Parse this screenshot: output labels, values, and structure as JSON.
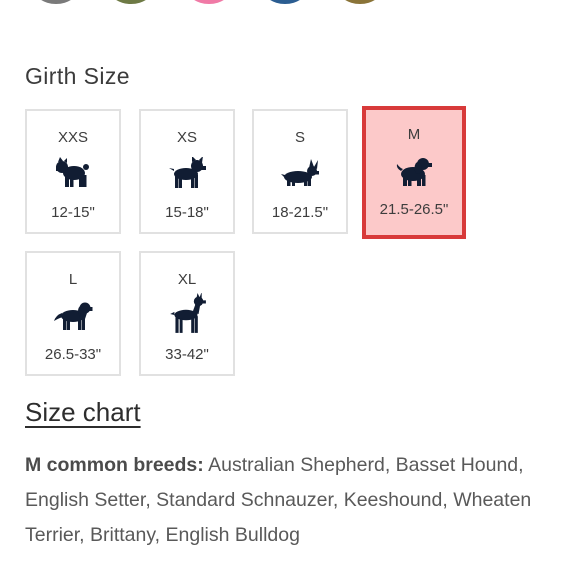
{
  "color_swatches": [
    {
      "color": "#7a7a7a"
    },
    {
      "color": "#6e7a45"
    },
    {
      "color": "#f07aa6"
    },
    {
      "color": "#2b5d91"
    },
    {
      "color": "#8a7438"
    }
  ],
  "girth": {
    "title": "Girth Size",
    "selected": "M",
    "sizes": [
      {
        "label": "XXS",
        "range": "12-15\"",
        "icon": "pug-icon"
      },
      {
        "label": "XS",
        "range": "15-18\"",
        "icon": "french-bulldog-icon"
      },
      {
        "label": "S",
        "range": "18-21.5\"",
        "icon": "corgi-icon"
      },
      {
        "label": "M",
        "range": "21.5-26.5\"",
        "icon": "spaniel-icon"
      },
      {
        "label": "L",
        "range": "26.5-33\"",
        "icon": "golden-retriever-icon"
      },
      {
        "label": "XL",
        "range": "33-42\"",
        "icon": "doberman-icon"
      }
    ]
  },
  "size_chart": {
    "label": "Size chart"
  },
  "breeds": {
    "title": "M common breeds:",
    "text": " Australian Shepherd, Basset Hound, English Setter, Standard Schnauzer, Keeshound, Wheaten Terrier, Brittany, English Bulldog"
  },
  "colors": {
    "selected_border": "#d83a3a",
    "selected_fill": "#fcc9c9",
    "card_border": "#e1e1e1",
    "icon": "#111d33"
  }
}
